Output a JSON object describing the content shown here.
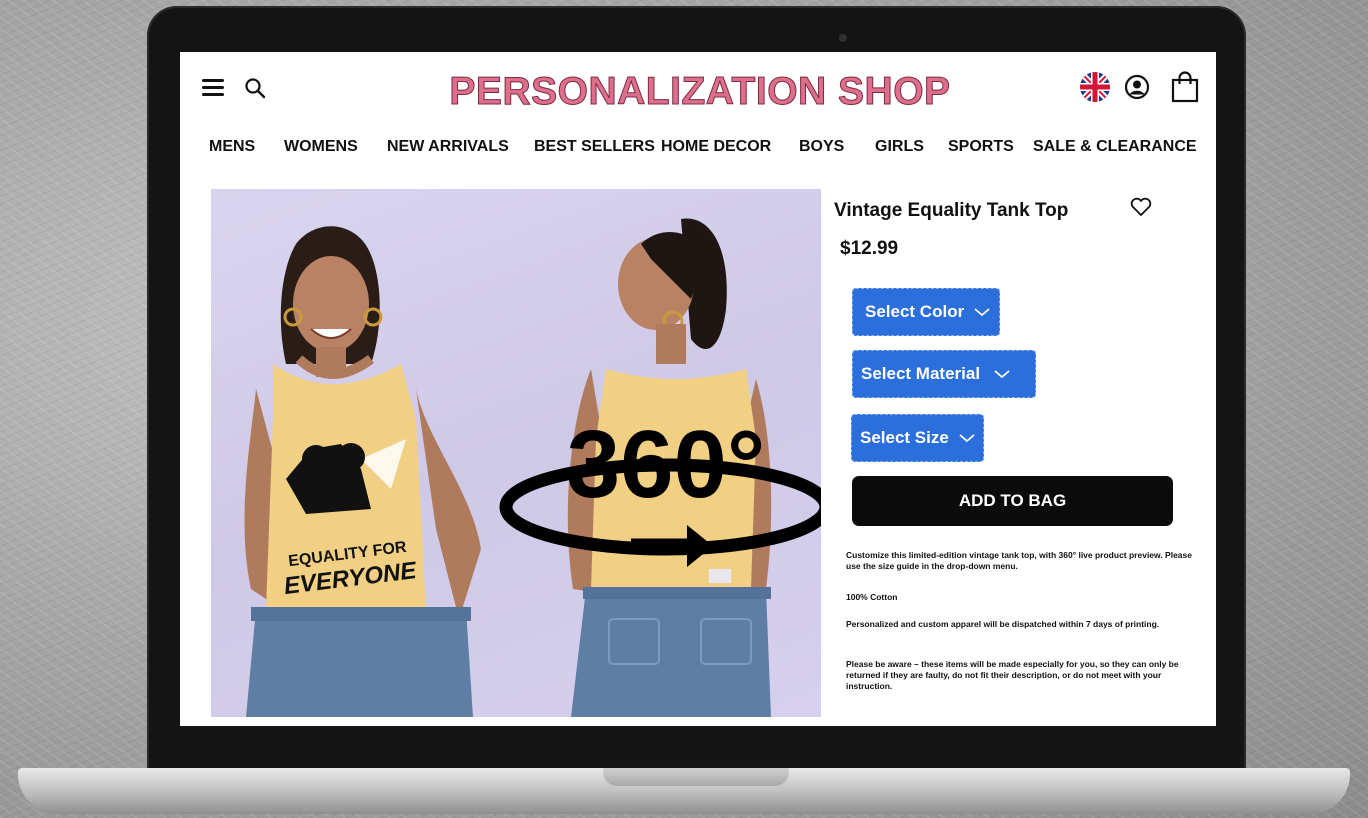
{
  "shop": {
    "logo_text": "PERSONALIZATION SHOP",
    "nav": [
      "MENS",
      "WOMENS",
      "NEW ARRIVALS",
      "BEST SELLERS",
      "HOME DECOR",
      "BOYS",
      "GIRLS",
      "SPORTS",
      "SALE & CLEARANCE"
    ]
  },
  "product": {
    "title": "Vintage Equality Tank Top",
    "price": "$12.99",
    "select_color_label": "Select Color",
    "select_material_label": "Select Material",
    "select_size_label": "Select Size",
    "add_to_bag_label": "ADD TO BAG",
    "image_overlay_text": "360°",
    "shirt_print_line1": "EQUALITY FOR",
    "shirt_print_line2": "EVERYONE",
    "description": [
      "Customize this limited-edition vintage tank top, with 360° live product preview. Please use the size guide in the drop-down menu.",
      "100% Cotton",
      "Personalized and custom apparel will be dispatched within 7 days of printing.",
      "Please be aware – these items will be made especially for you, so they can only be returned if they are faulty, do not fit their description, or do not meet with your instruction."
    ]
  },
  "colors": {
    "logo": "#dd6f8c",
    "select_button": "#2a6fdb",
    "add_button": "#0b0b0b",
    "image_background": "#d4cfec",
    "tank_top": "#f1cf83"
  },
  "icons": [
    "menu-icon",
    "search-icon",
    "uk-flag-icon",
    "account-icon",
    "shopping-bag-icon",
    "heart-icon",
    "chevron-down-icon",
    "rotate-360-icon"
  ]
}
